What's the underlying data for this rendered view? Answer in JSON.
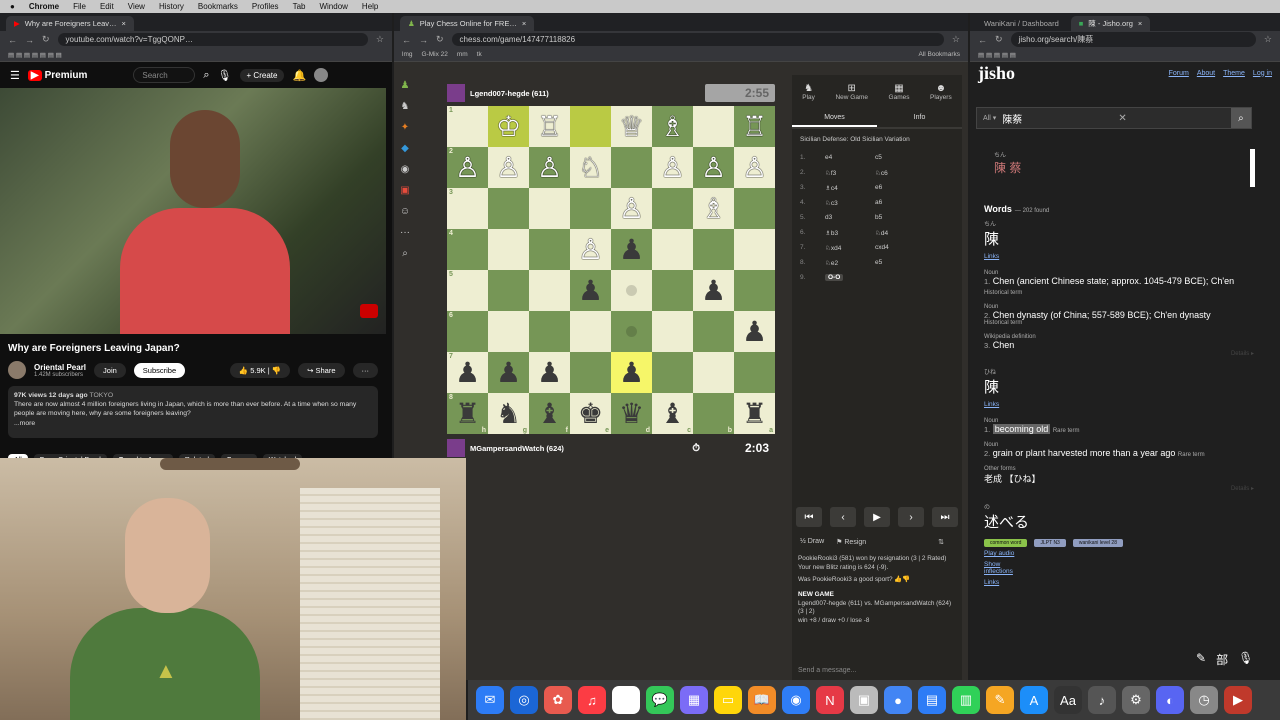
{
  "menubar": {
    "app": "Chrome",
    "items": [
      "File",
      "Edit",
      "View",
      "History",
      "Bookmarks",
      "Profiles",
      "Tab",
      "Window",
      "Help"
    ]
  },
  "youtube": {
    "tab": "Why are Foreigners Leav…",
    "url": "youtube.com/watch?v=TggQONP…",
    "logo": "Premium",
    "search_placeholder": "Search",
    "create": "Create",
    "title": "Why are Foreigners Leaving Japan?",
    "channel": "Oriental Pearl",
    "subs": "1.42M subscribers",
    "join": "Join",
    "subscribe": "Subscribe",
    "likes": "5.9K",
    "share": "Share",
    "desc_meta": "97K views  12 days ago",
    "desc_tag": "TOKYO",
    "desc": "There are now almost 4 million foreigners living in Japan, which is more than ever before. At a time when so many people are moving here, why are some foreigners leaving?",
    "more": "...more",
    "chips": [
      "All",
      "From Oriental Pearl",
      "Travel to Japan",
      "Related",
      "For you",
      "Watched"
    ]
  },
  "chess": {
    "tab": "Play Chess Online for FRE…",
    "url": "chess.com/game/147477118826",
    "bookmarks": [
      "lmg",
      "G-Mix 22",
      "mm",
      "tk",
      "All Bookmarks"
    ],
    "top_player": "Lgend007-hegde (611)",
    "top_clock": "2:55",
    "bottom_player": "MGampersandWatch (624)",
    "bottom_clock": "2:03",
    "board": [
      [
        {
          "p": "",
          "c": ""
        },
        {
          "p": "♔",
          "c": "w"
        },
        {
          "p": "♖",
          "c": "w"
        },
        {
          "p": "",
          "c": ""
        },
        {
          "p": "♕",
          "c": "w"
        },
        {
          "p": "♗",
          "c": "w"
        },
        {
          "p": "",
          "c": ""
        },
        {
          "p": "♖",
          "c": "w"
        }
      ],
      [
        {
          "p": "♙",
          "c": "w"
        },
        {
          "p": "♙",
          "c": "w"
        },
        {
          "p": "♙",
          "c": "w"
        },
        {
          "p": "♘",
          "c": "w"
        },
        {
          "p": "",
          "c": ""
        },
        {
          "p": "♙",
          "c": "w"
        },
        {
          "p": "♙",
          "c": "w"
        },
        {
          "p": "♙",
          "c": "w"
        }
      ],
      [
        {
          "p": "",
          "c": ""
        },
        {
          "p": "",
          "c": ""
        },
        {
          "p": "",
          "c": ""
        },
        {
          "p": "",
          "c": ""
        },
        {
          "p": "♙",
          "c": "w"
        },
        {
          "p": "",
          "c": ""
        },
        {
          "p": "♗",
          "c": "w"
        },
        {
          "p": "",
          "c": ""
        }
      ],
      [
        {
          "p": "",
          "c": ""
        },
        {
          "p": "",
          "c": ""
        },
        {
          "p": "",
          "c": ""
        },
        {
          "p": "♙",
          "c": "w"
        },
        {
          "p": "♟",
          "c": "b"
        },
        {
          "p": "",
          "c": ""
        },
        {
          "p": "",
          "c": ""
        },
        {
          "p": "",
          "c": ""
        }
      ],
      [
        {
          "p": "",
          "c": ""
        },
        {
          "p": "",
          "c": ""
        },
        {
          "p": "",
          "c": ""
        },
        {
          "p": "♟",
          "c": "b"
        },
        {
          "p": "",
          "c": "dot"
        },
        {
          "p": "",
          "c": ""
        },
        {
          "p": "♟",
          "c": "b"
        },
        {
          "p": "",
          "c": ""
        }
      ],
      [
        {
          "p": "",
          "c": ""
        },
        {
          "p": "",
          "c": ""
        },
        {
          "p": "",
          "c": ""
        },
        {
          "p": "",
          "c": ""
        },
        {
          "p": "",
          "c": "dot"
        },
        {
          "p": "",
          "c": ""
        },
        {
          "p": "",
          "c": ""
        },
        {
          "p": "♟",
          "c": "b"
        }
      ],
      [
        {
          "p": "♟",
          "c": "b"
        },
        {
          "p": "♟",
          "c": "b"
        },
        {
          "p": "♟",
          "c": "b"
        },
        {
          "p": "",
          "c": ""
        },
        {
          "p": "♟",
          "c": "b"
        },
        {
          "p": "",
          "c": ""
        },
        {
          "p": "",
          "c": ""
        },
        {
          "p": "",
          "c": ""
        }
      ],
      [
        {
          "p": "♜",
          "c": "b"
        },
        {
          "p": "♞",
          "c": "b"
        },
        {
          "p": "♝",
          "c": "b"
        },
        {
          "p": "♚",
          "c": "b"
        },
        {
          "p": "♛",
          "c": "b"
        },
        {
          "p": "♝",
          "c": "b"
        },
        {
          "p": "",
          "c": ""
        },
        {
          "p": "♜",
          "c": "b"
        }
      ]
    ],
    "ranks": [
      "1",
      "2",
      "3",
      "4",
      "5",
      "6",
      "7",
      "8"
    ],
    "files": [
      "h",
      "g",
      "f",
      "e",
      "d",
      "c",
      "b",
      "a"
    ],
    "panel_tabs": [
      "Play",
      "New Game",
      "Games",
      "Players"
    ],
    "moves_tab": "Moves",
    "info_tab": "Info",
    "opening": "Sicilian Defense: Old Sicilian Variation",
    "moves": [
      {
        "n": "1.",
        "w": "e4",
        "b": "c5"
      },
      {
        "n": "2.",
        "w": "♘f3",
        "b": "♘c6"
      },
      {
        "n": "3.",
        "w": "♗c4",
        "b": "e6"
      },
      {
        "n": "4.",
        "w": "♘c3",
        "b": "a6"
      },
      {
        "n": "5.",
        "w": "d3",
        "b": "b5"
      },
      {
        "n": "6.",
        "w": "♗b3",
        "b": "♘d4"
      },
      {
        "n": "7.",
        "w": "♘xd4",
        "b": "cxd4"
      },
      {
        "n": "8.",
        "w": "♘e2",
        "b": "e5"
      },
      {
        "n": "9.",
        "w": "O-O",
        "b": ""
      }
    ],
    "draw": "Draw",
    "resign": "Resign",
    "chat": [
      "PookieRooki3 (581) won by resignation (3 | 2 Rated)",
      "Your new Blitz rating is 624 (-9).",
      "Was PookieRooki3 a good sport?",
      "NEW GAME",
      "Lgend007-hegde (611) vs. MGampersandWatch (624) (3 | 2)",
      "win +8 / draw +0 / lose -8"
    ],
    "send": "Send a message..."
  },
  "jisho": {
    "tab1": "WaniKani / Dashboard",
    "tab2": "陳 - Jisho.org",
    "url": "jisho.org/search/陳蔡",
    "logo": "jisho",
    "nav": [
      "Forum",
      "About",
      "Theme",
      "Log in"
    ],
    "scope": "All",
    "query": "陳蔡",
    "furi_top": "ちん",
    "kanji_top": "陳 蔡",
    "words_label": "Words",
    "found": "— 202 found",
    "entries": [
      {
        "furigana": "ちん",
        "word": "陳",
        "links": "Links",
        "senses": [
          {
            "pos": "Noun",
            "num": "1.",
            "text": "Chen (ancient Chinese state; approx. 1045-479 BCE); Ch'en",
            "tag": "Historical term"
          },
          {
            "pos": "Noun",
            "num": "2.",
            "text": "Chen dynasty (of China; 557-589 BCE); Ch'en dynasty",
            "tag": "Historical term"
          },
          {
            "pos": "Wikipedia definition",
            "num": "3.",
            "text": "Chen",
            "tag": ""
          }
        ]
      },
      {
        "furigana": "ひね",
        "word": "陳",
        "links": "Links",
        "senses": [
          {
            "pos": "Noun",
            "num": "1.",
            "text": "becoming old",
            "tag": "Rare term"
          },
          {
            "pos": "Noun",
            "num": "2.",
            "text": "grain or plant harvested more than a year ago",
            "tag": "Rare term"
          },
          {
            "pos": "Other forms",
            "num": "",
            "text": "老成 【ひね】",
            "tag": ""
          }
        ]
      }
    ],
    "details": "Details ▸",
    "entry3_furi": "の",
    "entry3_word": "述べる",
    "entry3_tags": [
      "common word",
      "JLPT N3",
      "wanikani level 28"
    ],
    "play_audio": "Play audio",
    "show_inflections": "Show inflections",
    "links": "Links"
  },
  "dock": [
    "✉",
    "◎",
    "✿",
    "♫",
    "☰",
    "💬",
    "▦",
    "▭",
    "📖",
    "◉",
    "N",
    "▣",
    "●",
    "▤",
    "▥",
    "✎",
    "A",
    "Aa",
    "♪",
    "⚙",
    "◐",
    "◷",
    "▶"
  ]
}
